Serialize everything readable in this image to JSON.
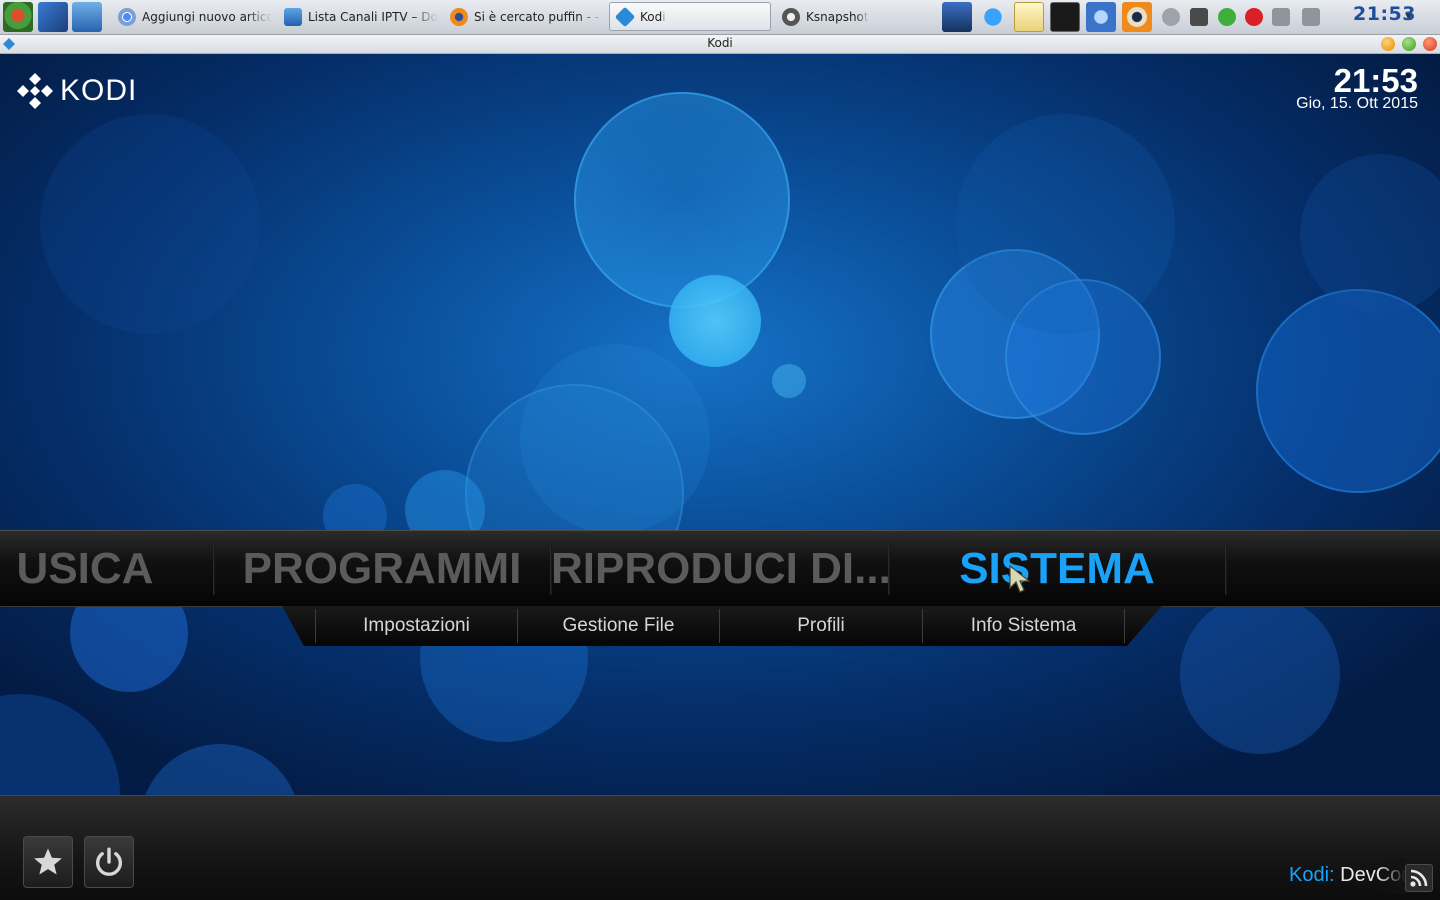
{
  "taskbar": {
    "tasks": [
      {
        "label": "Aggiungi nuovo articolo",
        "icon": "chrome-icon"
      },
      {
        "label": "Lista Canali IPTV – Dol",
        "icon": "dolphin-icon"
      },
      {
        "label": "Si è cercato puffin - - M",
        "icon": "firefox-icon"
      },
      {
        "label": "Kodi",
        "icon": "kodi-icon"
      },
      {
        "label": "Ksnapshot",
        "icon": "camera-icon"
      }
    ],
    "clock": "21:53"
  },
  "window": {
    "title": "Kodi"
  },
  "kodi": {
    "logo_text": "KODI",
    "time": "21:53",
    "date": "Gio, 15. Ott 2015",
    "menu": [
      {
        "label": "USICA",
        "focused": false
      },
      {
        "label": "PROGRAMMI",
        "focused": false
      },
      {
        "label": "RIPRODUCI DI...",
        "focused": false
      },
      {
        "label": "SISTEMA",
        "focused": true
      }
    ],
    "submenu": [
      "Impostazioni",
      "Gestione File",
      "Profili",
      "Info Sistema"
    ],
    "bottom": {
      "favourites_icon": "star-icon",
      "power_icon": "power-icon",
      "rss_label": "Kodi:",
      "rss_headline": "DevCon"
    },
    "colors": {
      "accent": "#19a2f7",
      "menu_inactive": "#5b5b5b",
      "background_blue": "#0a4f9a"
    }
  }
}
